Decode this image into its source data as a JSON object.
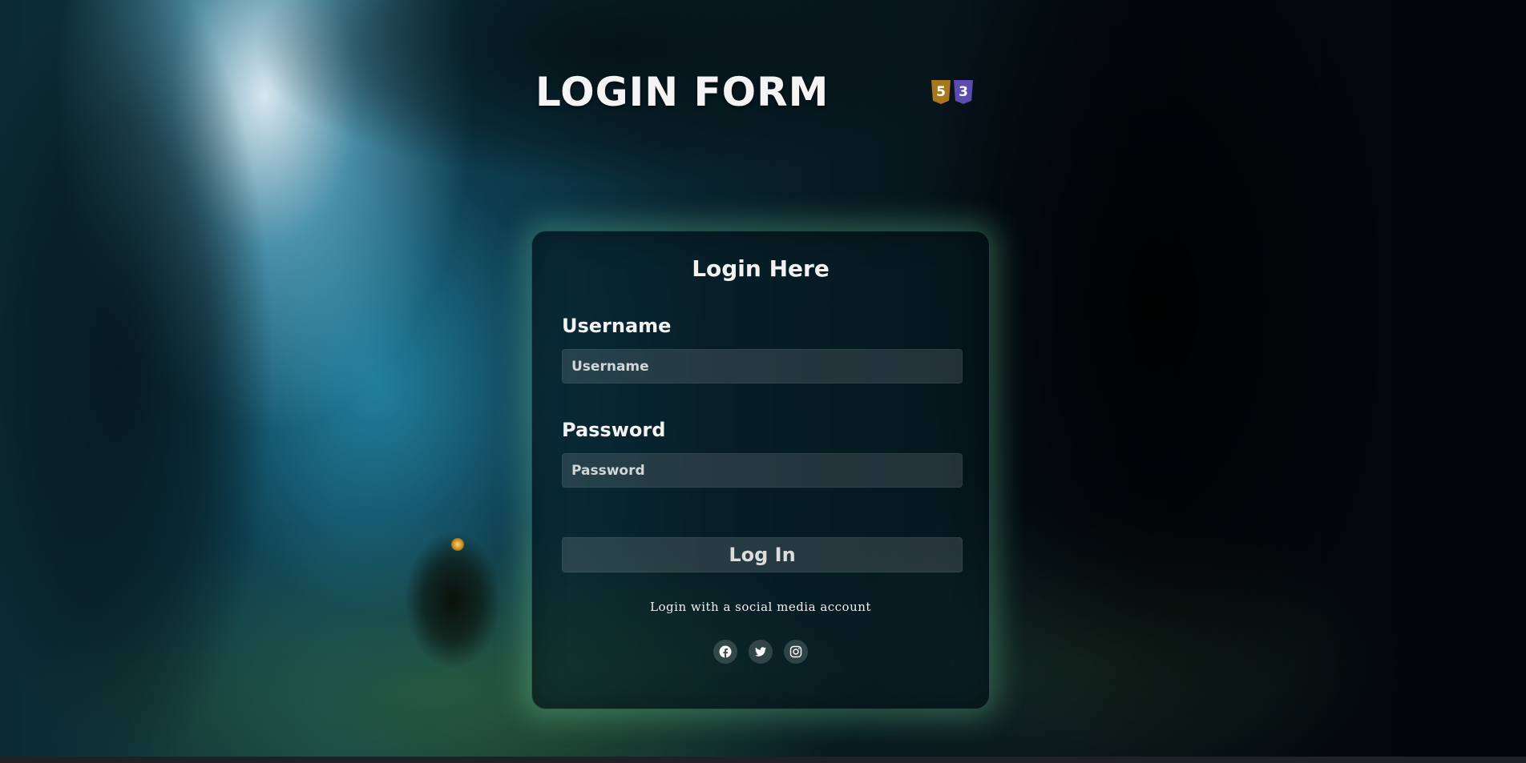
{
  "header": {
    "title": "LOGIN FORM",
    "badges": [
      {
        "icon": "html5-icon",
        "glyph": "5",
        "color": "#a8771d"
      },
      {
        "icon": "css3-icon",
        "glyph": "3",
        "color": "#5b4cb0"
      }
    ]
  },
  "form": {
    "title": "Login Here",
    "username_label": "Username",
    "username_placeholder": "Username",
    "username_value": "",
    "password_label": "Password",
    "password_placeholder": "Password",
    "password_value": "",
    "submit_label": "Log In",
    "social_caption": "Login with a social media account",
    "social": [
      {
        "icon": "facebook-icon"
      },
      {
        "icon": "twitter-icon"
      },
      {
        "icon": "instagram-icon"
      }
    ]
  },
  "colors": {
    "card_glow": "#8cffbe",
    "text": "#f2f2f2"
  }
}
